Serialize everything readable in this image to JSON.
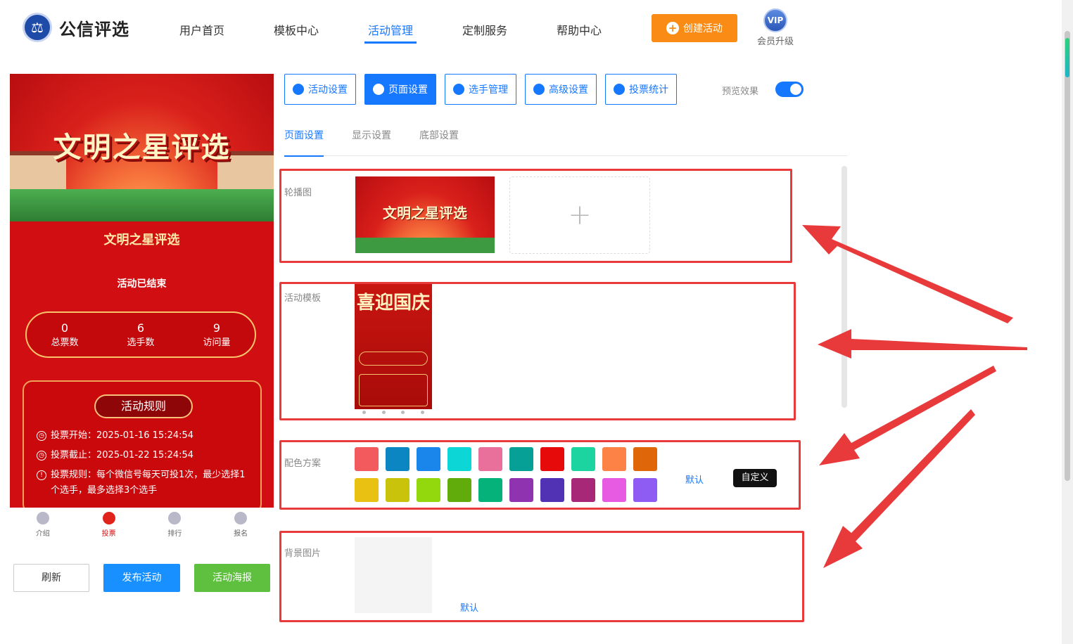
{
  "header": {
    "logo_text": "公信评选",
    "nav": [
      "用户首页",
      "模板中心",
      "活动管理",
      "定制服务",
      "帮助中心"
    ],
    "create_label": "创建活动",
    "vip_badge": "VIP",
    "vip_label": "会员升级"
  },
  "preview": {
    "banner_title": "文明之星评选",
    "title": "文明之星评选",
    "status": "活动已结束",
    "stats": [
      {
        "num": "0",
        "label": "总票数"
      },
      {
        "num": "6",
        "label": "选手数"
      },
      {
        "num": "9",
        "label": "访问量"
      }
    ],
    "rules_title": "活动规则",
    "rules": [
      "投票开始：2025-01-16 15:24:54",
      "投票截止：2025-01-22 15:24:54",
      "投票规则：每个微信号每天可投1次，最少选择1个选手，最多选择3个选手"
    ],
    "tabbar": [
      "介绍",
      "投票",
      "排行",
      "报名"
    ],
    "buttons": {
      "refresh": "刷新",
      "publish": "发布活动",
      "poster": "活动海报"
    }
  },
  "settings": {
    "top_tabs": [
      "活动设置",
      "页面设置",
      "选手管理",
      "高级设置",
      "投票统计"
    ],
    "preview_label": "预览效果",
    "sub_tabs": [
      "页面设置",
      "显示设置",
      "底部设置"
    ],
    "carousel_label": "轮播图",
    "carousel_thumb_title": "文明之星评选",
    "template_label": "活动模板",
    "template_thumb_title": "喜迎国庆",
    "color_label": "配色方案",
    "colors": [
      "#f25a5e",
      "#0b86c3",
      "#1a86ec",
      "#0dd6d6",
      "#e8709a",
      "#06a096",
      "#e60a0a",
      "#1bd4a0",
      "#fd8245",
      "#e0660a",
      "#e9c112",
      "#c9c30b",
      "#93d70d",
      "#61ac0b",
      "#05b37a",
      "#8f33b0",
      "#5132b5",
      "#a72876",
      "#e75be3",
      "#8e5cf2"
    ],
    "color_default": "默认",
    "color_custom": "自定义",
    "bg_label": "背景图片",
    "bg_default": "默认"
  }
}
